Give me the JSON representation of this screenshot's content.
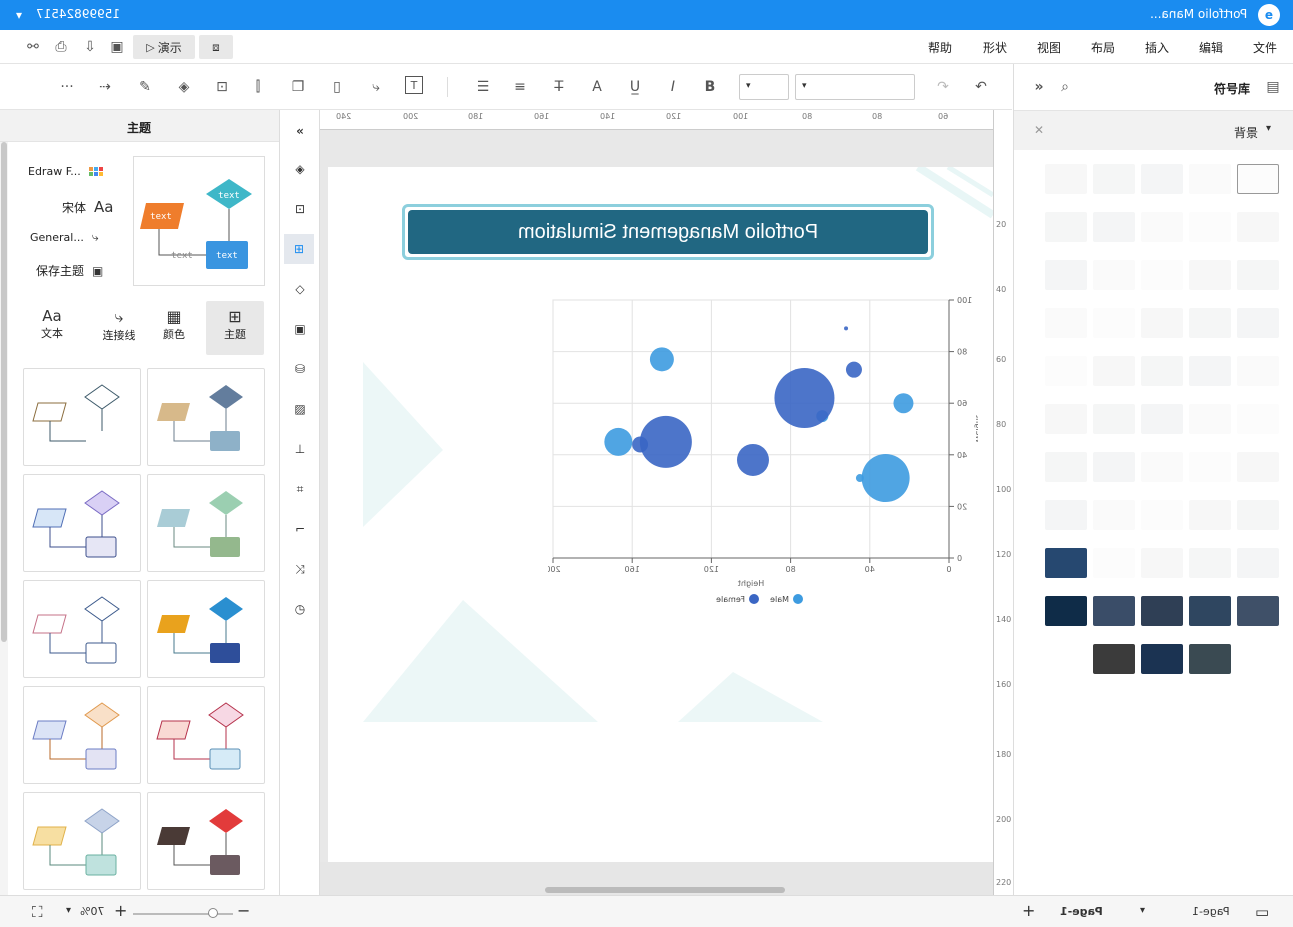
{
  "titlebar": {
    "phone": "15999824517",
    "doc_title": "Portfolio Mana..."
  },
  "menu": {
    "items": [
      "文件",
      "编辑",
      "插入",
      "布局",
      "视图",
      "形状",
      "帮助"
    ],
    "present": "演示"
  },
  "toolbar": {
    "font_select": "",
    "size_select": ""
  },
  "rightpanel": {
    "title": "符号库",
    "section": "背景"
  },
  "leftpanel": {
    "title": "主题",
    "theme_links": [
      "Edraw F...",
      "宋体",
      "General...",
      "保存主题"
    ],
    "tabs": [
      "主题",
      "颜色",
      "连接线",
      "文本"
    ],
    "preview_text": "text"
  },
  "canvas": {
    "ruler_top": [
      "240",
      "220",
      "200",
      "180",
      "160",
      "140",
      "120",
      "100",
      "80",
      "60"
    ],
    "ruler_left": [
      "20",
      "40",
      "60",
      "80",
      "100",
      "120",
      "140",
      "160",
      "180",
      "200",
      "220"
    ],
    "banner_title": "Portfolio Management Simulatiom"
  },
  "chart_data": {
    "type": "scatter",
    "subtype": "bubble",
    "title": "",
    "xlabel": "Height",
    "ylabel": "Weight",
    "xlim": [
      0,
      200
    ],
    "ylim": [
      0,
      100
    ],
    "xticks": [
      "0",
      "40",
      "80",
      "120",
      "160",
      "200"
    ],
    "yticks": [
      "0",
      "20",
      "40",
      "60",
      "80",
      "100"
    ],
    "grid": true,
    "legend_position": "bottom",
    "series": [
      {
        "name": "Male",
        "color": "#3d9be0",
        "points": [
          {
            "x": 167,
            "y": 45,
            "r": 7
          },
          {
            "x": 145,
            "y": 77,
            "r": 6
          },
          {
            "x": 64,
            "y": 55,
            "r": 3
          },
          {
            "x": 23,
            "y": 60,
            "r": 5
          },
          {
            "x": 32,
            "y": 31,
            "r": 12
          },
          {
            "x": 45,
            "y": 31,
            "r": 2
          }
        ]
      },
      {
        "name": "Female",
        "color": "#3a66c4",
        "points": [
          {
            "x": 156,
            "y": 44,
            "r": 4
          },
          {
            "x": 143,
            "y": 45,
            "r": 13
          },
          {
            "x": 99,
            "y": 38,
            "r": 8
          },
          {
            "x": 73,
            "y": 62,
            "r": 15
          },
          {
            "x": 48,
            "y": 73,
            "r": 4
          },
          {
            "x": 52,
            "y": 89,
            "r": 1
          }
        ]
      }
    ]
  },
  "status": {
    "zoom": "70%",
    "page_select": "Page-1",
    "page_tab": "Page-1"
  },
  "colors": {
    "brand": "#1a8cf0",
    "banner": "#216782",
    "banner_border": "#8ccfdd"
  }
}
